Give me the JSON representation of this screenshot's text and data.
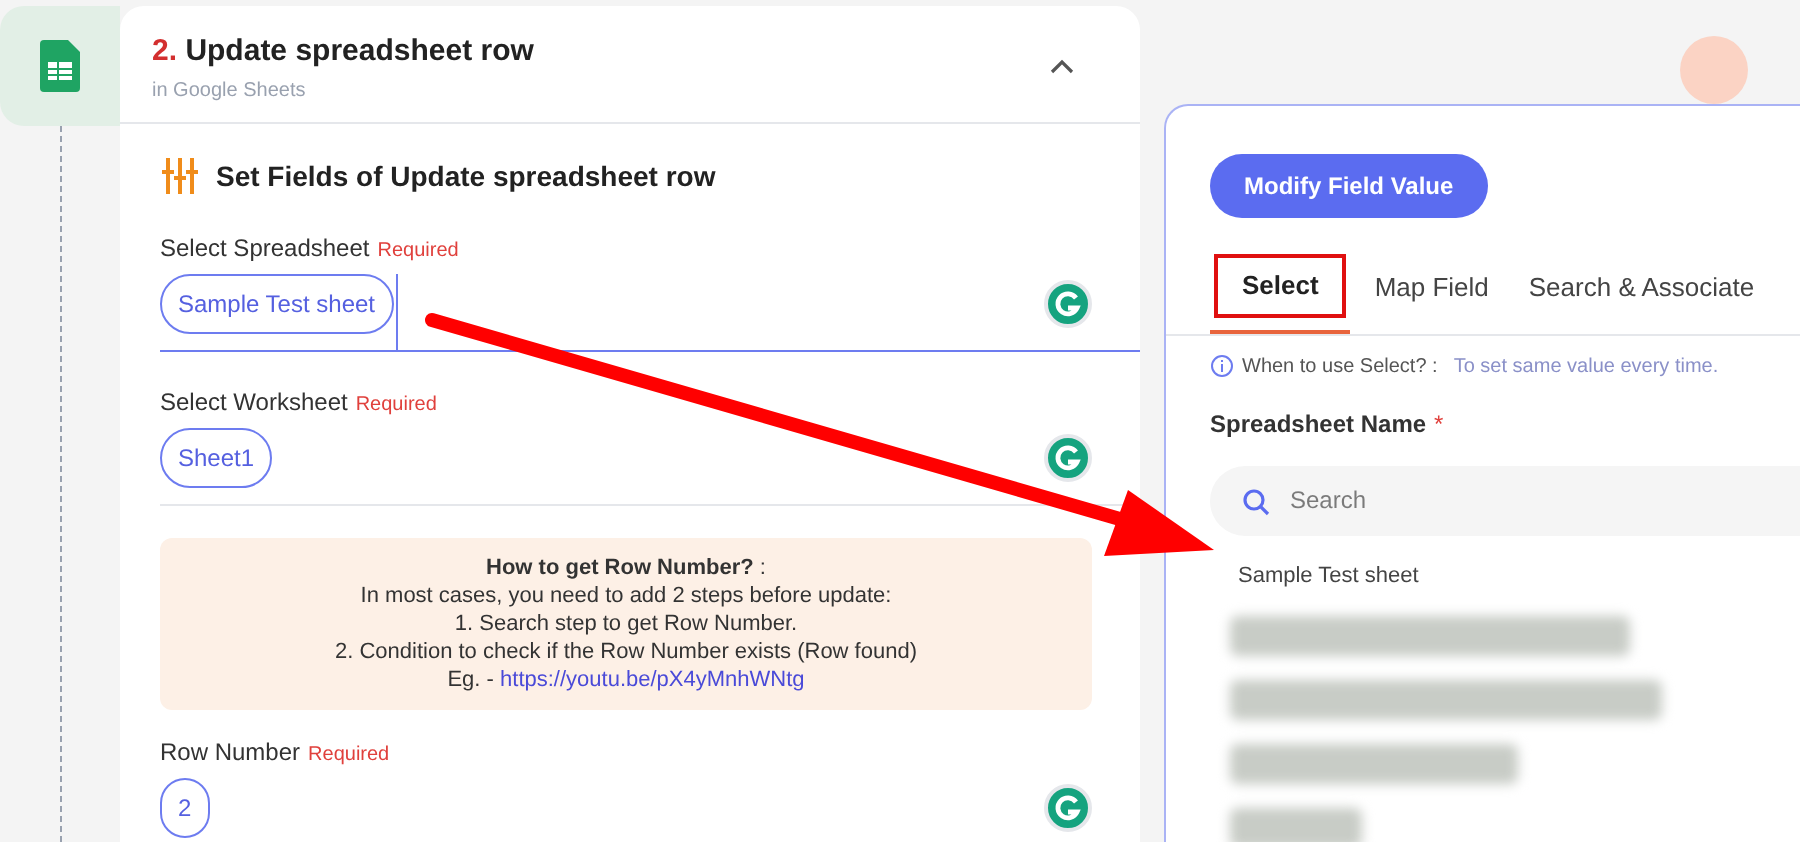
{
  "step": {
    "number": "2.",
    "title": "Update spreadsheet row",
    "subtitle": "in Google Sheets",
    "expanded": true
  },
  "section_title": "Set Fields of Update spreadsheet row",
  "fields": [
    {
      "label": "Select Spreadsheet",
      "required": "Required",
      "value": "Sample Test sheet",
      "focused": true
    },
    {
      "label": "Select Worksheet",
      "required": "Required",
      "value": "Sheet1",
      "focused": false
    }
  ],
  "help": {
    "title": "How to get Row Number?",
    "title_suffix": " :",
    "lines": [
      "In most cases, you need to add 2 steps before update:",
      "1. Search step to get Row Number.",
      "2. Condition to check if the Row Number exists (Row found)"
    ],
    "link_prefix": "Eg. - ",
    "link": "https://youtu.be/pX4yMnhWNtg"
  },
  "row_field": {
    "label": "Row Number",
    "required": "Required",
    "value": "2"
  },
  "panel": {
    "button": "Modify Field Value",
    "tabs": [
      {
        "label": "Select",
        "selected": true
      },
      {
        "label": "Map Field",
        "selected": false
      },
      {
        "label": "Search & Associate",
        "selected": false
      }
    ],
    "hint_label": "When to use Select? :",
    "hint_text": "To set same value every time.",
    "list_label": "Spreadsheet Name",
    "required_mark": "*",
    "search": {
      "placeholder": "Search"
    },
    "options": [
      {
        "kind": "text",
        "label": "Sample Test sheet"
      },
      {
        "kind": "blurred"
      },
      {
        "kind": "blurred"
      },
      {
        "kind": "blurred"
      },
      {
        "kind": "blurred"
      }
    ]
  }
}
